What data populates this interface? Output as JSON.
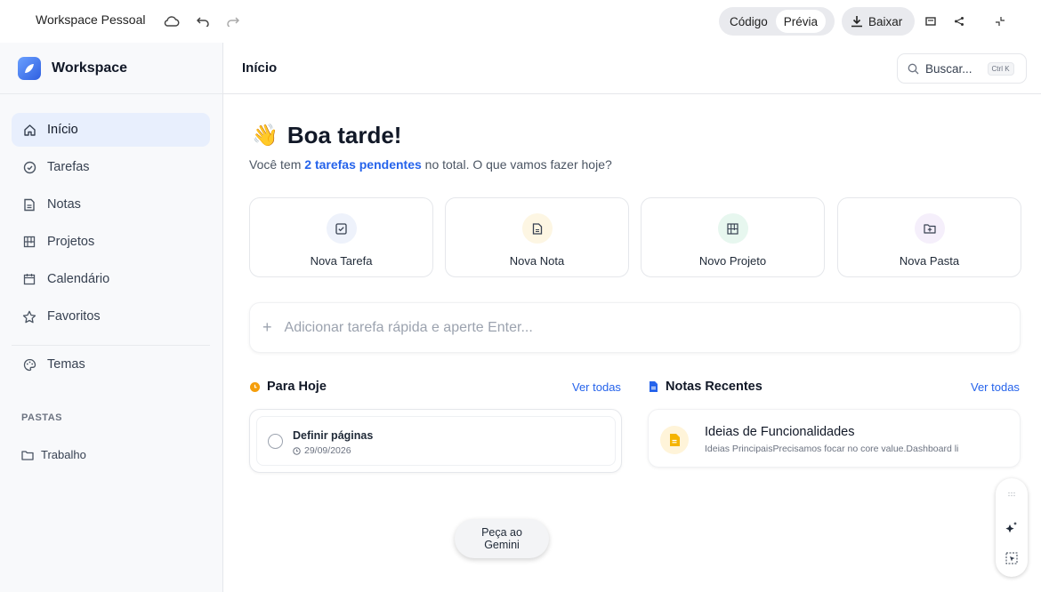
{
  "topbar": {
    "workspace_name": "Workspace Pessoal",
    "mode_code": "Código",
    "mode_preview": "Prévia",
    "download_label": "Baixar"
  },
  "sidebar": {
    "brand": "Workspace",
    "items": [
      {
        "label": "Início",
        "icon": "home-icon",
        "active": true
      },
      {
        "label": "Tarefas",
        "icon": "check-circle-icon"
      },
      {
        "label": "Notas",
        "icon": "note-icon"
      },
      {
        "label": "Projetos",
        "icon": "kanban-icon"
      },
      {
        "label": "Calendário",
        "icon": "calendar-icon"
      },
      {
        "label": "Favoritos",
        "icon": "star-icon"
      },
      {
        "label": "Temas",
        "icon": "palette-icon"
      }
    ],
    "folders_heading": "PASTAS",
    "folders": [
      {
        "label": "Trabalho",
        "icon": "folder-icon"
      }
    ]
  },
  "header": {
    "title": "Início",
    "search_label": "Buscar...",
    "search_shortcut": "Ctrl K"
  },
  "greeting": {
    "emoji": "👋",
    "title": "Boa tarde!",
    "sub_before": "Você tem ",
    "sub_highlight": "2 tarefas pendentes",
    "sub_after": " no total. O que vamos fazer hoje?"
  },
  "actions": [
    {
      "label": "Nova Tarefa",
      "icon": "checkbox-icon",
      "bg": "#eef2fb"
    },
    {
      "label": "Nova Nota",
      "icon": "document-icon",
      "bg": "#fdf6e3"
    },
    {
      "label": "Novo Projeto",
      "icon": "kanban-icon",
      "bg": "#e7f7ef"
    },
    {
      "label": "Nova Pasta",
      "icon": "folder-plus-icon",
      "bg": "#f5effb"
    }
  ],
  "quick_add": {
    "placeholder": "Adicionar tarefa rápida e aperte Enter..."
  },
  "today": {
    "title": "Para Hoje",
    "view_all": "Ver todas",
    "tasks": [
      {
        "title": "Definir páginas",
        "date": "29/09/2026"
      }
    ]
  },
  "notes": {
    "title": "Notas Recentes",
    "view_all": "Ver todas",
    "items": [
      {
        "title": "Ideias de Funcionalidades",
        "preview": "Ideias PrincipaisPrecisamos focar no core value.Dashboard li"
      }
    ]
  },
  "gemini": {
    "line1": "Peça ao",
    "line2": "Gemini"
  },
  "colors": {
    "accent": "#2563eb",
    "today_dot": "#f59e0b",
    "note_icon": "#f5b400"
  }
}
